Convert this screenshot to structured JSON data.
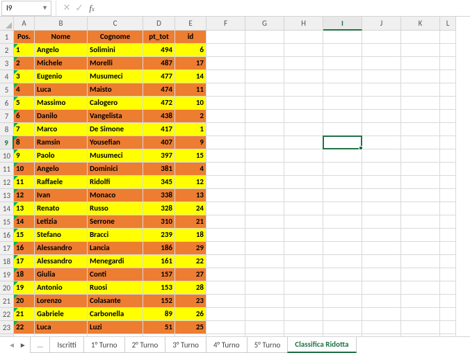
{
  "active_cell_ref": "I9",
  "columns": [
    "A",
    "B",
    "C",
    "D",
    "E",
    "F",
    "G",
    "H",
    "I",
    "J",
    "K",
    "L"
  ],
  "col_classes": [
    "wA",
    "wB",
    "wC",
    "wD",
    "wE",
    "wF",
    "wG",
    "wH",
    "wI",
    "wJ",
    "wK",
    "wL"
  ],
  "active_col_idx": 8,
  "active_row_num": 9,
  "row_count": 24,
  "header": {
    "pos": "Pos.",
    "nome": "Nome",
    "cognome": "Cognome",
    "pt_tot": "pt_tot",
    "id": "id"
  },
  "rows": [
    {
      "pos": 1,
      "nome": "Angelo",
      "cognome": "Solimini",
      "pt": 494,
      "id": 6,
      "c": "yellow"
    },
    {
      "pos": 2,
      "nome": "Michele",
      "cognome": "Morelli",
      "pt": 487,
      "id": 17,
      "c": "orange"
    },
    {
      "pos": 3,
      "nome": "Eugenio",
      "cognome": "Musumeci",
      "pt": 477,
      "id": 14,
      "c": "yellow"
    },
    {
      "pos": 4,
      "nome": "Luca",
      "cognome": "Maisto",
      "pt": 474,
      "id": 11,
      "c": "orange"
    },
    {
      "pos": 5,
      "nome": "Massimo",
      "cognome": "Calogero",
      "pt": 472,
      "id": 10,
      "c": "yellow"
    },
    {
      "pos": 6,
      "nome": "Danilo",
      "cognome": "Vangelista",
      "pt": 438,
      "id": 2,
      "c": "orange"
    },
    {
      "pos": 7,
      "nome": "Marco",
      "cognome": "De Simone",
      "pt": 417,
      "id": 1,
      "c": "yellow"
    },
    {
      "pos": 8,
      "nome": "Ramsin",
      "cognome": "Yousefian",
      "pt": 407,
      "id": 9,
      "c": "orange"
    },
    {
      "pos": 9,
      "nome": "Paolo",
      "cognome": "Musumeci",
      "pt": 397,
      "id": 15,
      "c": "yellow"
    },
    {
      "pos": 10,
      "nome": "Angelo",
      "cognome": "Dominici",
      "pt": 381,
      "id": 4,
      "c": "orange"
    },
    {
      "pos": 11,
      "nome": "Raffaele",
      "cognome": "Ridolfi",
      "pt": 345,
      "id": 12,
      "c": "yellow"
    },
    {
      "pos": 12,
      "nome": "Ivan",
      "cognome": "Monaco",
      "pt": 338,
      "id": 13,
      "c": "orange"
    },
    {
      "pos": 13,
      "nome": "Renato",
      "cognome": "Russo",
      "pt": 328,
      "id": 24,
      "c": "yellow"
    },
    {
      "pos": 14,
      "nome": "Letizia",
      "cognome": "Serrone",
      "pt": 310,
      "id": 21,
      "c": "orange"
    },
    {
      "pos": 15,
      "nome": "Stefano",
      "cognome": "Bracci",
      "pt": 239,
      "id": 18,
      "c": "yellow"
    },
    {
      "pos": 16,
      "nome": "Alessandro",
      "cognome": "Lancia",
      "pt": 186,
      "id": 29,
      "c": "orange"
    },
    {
      "pos": 17,
      "nome": "Alessandro",
      "cognome": "Menegardi",
      "pt": 161,
      "id": 22,
      "c": "yellow"
    },
    {
      "pos": 18,
      "nome": "Giulia",
      "cognome": "Conti",
      "pt": 157,
      "id": 27,
      "c": "orange"
    },
    {
      "pos": 19,
      "nome": "Antonio",
      "cognome": "Ruosi",
      "pt": 153,
      "id": 28,
      "c": "yellow"
    },
    {
      "pos": 20,
      "nome": "Lorenzo",
      "cognome": "Colasante",
      "pt": 152,
      "id": 23,
      "c": "orange"
    },
    {
      "pos": 21,
      "nome": "Gabriele",
      "cognome": "Carbonella",
      "pt": 89,
      "id": 26,
      "c": "yellow"
    },
    {
      "pos": 22,
      "nome": "Luca",
      "cognome": "Luzi",
      "pt": 51,
      "id": 25,
      "c": "orange"
    }
  ],
  "tabs": {
    "overflow": "…",
    "items": [
      "Iscritti",
      "1° Turno",
      "2° Turno",
      "3° Turno",
      "4° Turno",
      "5° Turno",
      "Classifica Ridotta"
    ],
    "active_idx": 6
  }
}
